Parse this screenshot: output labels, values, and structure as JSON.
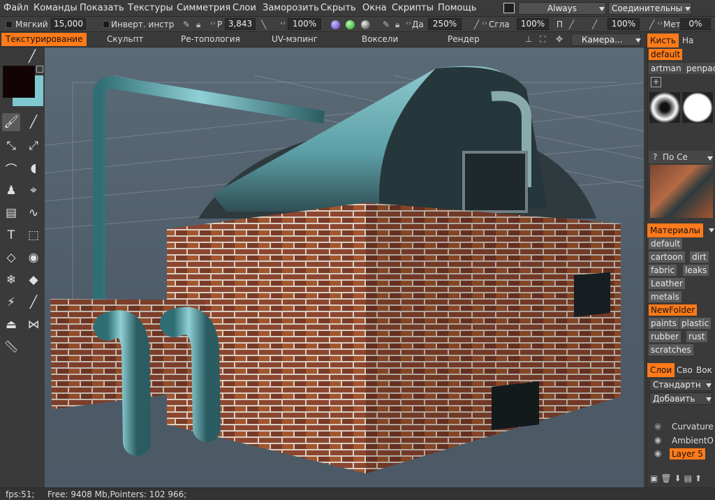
{
  "menu": {
    "items": [
      "Файл",
      "Команды",
      "Показать",
      "Текстуры",
      "Симметрия",
      "Слои",
      "Заморозить",
      "Скрыть",
      "Окна",
      "Скрипты",
      "Помощь"
    ],
    "always_label": "Always",
    "connectivity_label": "Соединительны"
  },
  "options": {
    "soft_label": "Мягкий",
    "soft_value": "15,000",
    "invert_label": "Инверт. инстр",
    "radius_label": "Р",
    "radius_value": "3,843",
    "depth_value": "100%",
    "da_label": "Да",
    "da_value": "250%",
    "smooth_label": "Сгла",
    "smooth_value": "100%",
    "p_label": "П",
    "p_value": "100%",
    "met_label": "Мет",
    "met_value": "0%"
  },
  "rooms": {
    "tabs": [
      "Текстурирование",
      "Скульпт",
      "Ре-топология",
      "UV-мэпинг",
      "Воксели",
      "Рендер"
    ],
    "camera_label": "Камера..."
  },
  "brush_panel": {
    "tabs": [
      "Кисть",
      "На"
    ],
    "presets": [
      "default",
      "artman",
      "penpac"
    ],
    "stencil_search": "По Се"
  },
  "materials_panel": {
    "title": "Материалы",
    "tags": [
      "default",
      "cartoon",
      "dirt",
      "fabric",
      "leaks",
      "Leather",
      "metals",
      "NewFolder",
      "paints",
      "plastic",
      "rubber",
      "rust",
      "scratches"
    ],
    "active_tag": "NewFolder"
  },
  "layers_panel": {
    "tabs": [
      "Слои",
      "Сво",
      "Вок"
    ],
    "blend_mode": "Стандартн",
    "add_label": "Добавить",
    "layers": [
      "Curvature",
      "AmbientO",
      "Layer 5"
    ],
    "active_layer": "Layer 5"
  },
  "status": {
    "fps": "fps:51;",
    "memory": "Free: 9408 Mb,Pointers: 102 966;"
  },
  "colors": {
    "accent": "#ff7a1a",
    "primary_color": "#120404",
    "secondary_color": "#7fc8d0",
    "pipe_teal": "#5fa6ad",
    "brick": "#8a4a2c"
  }
}
